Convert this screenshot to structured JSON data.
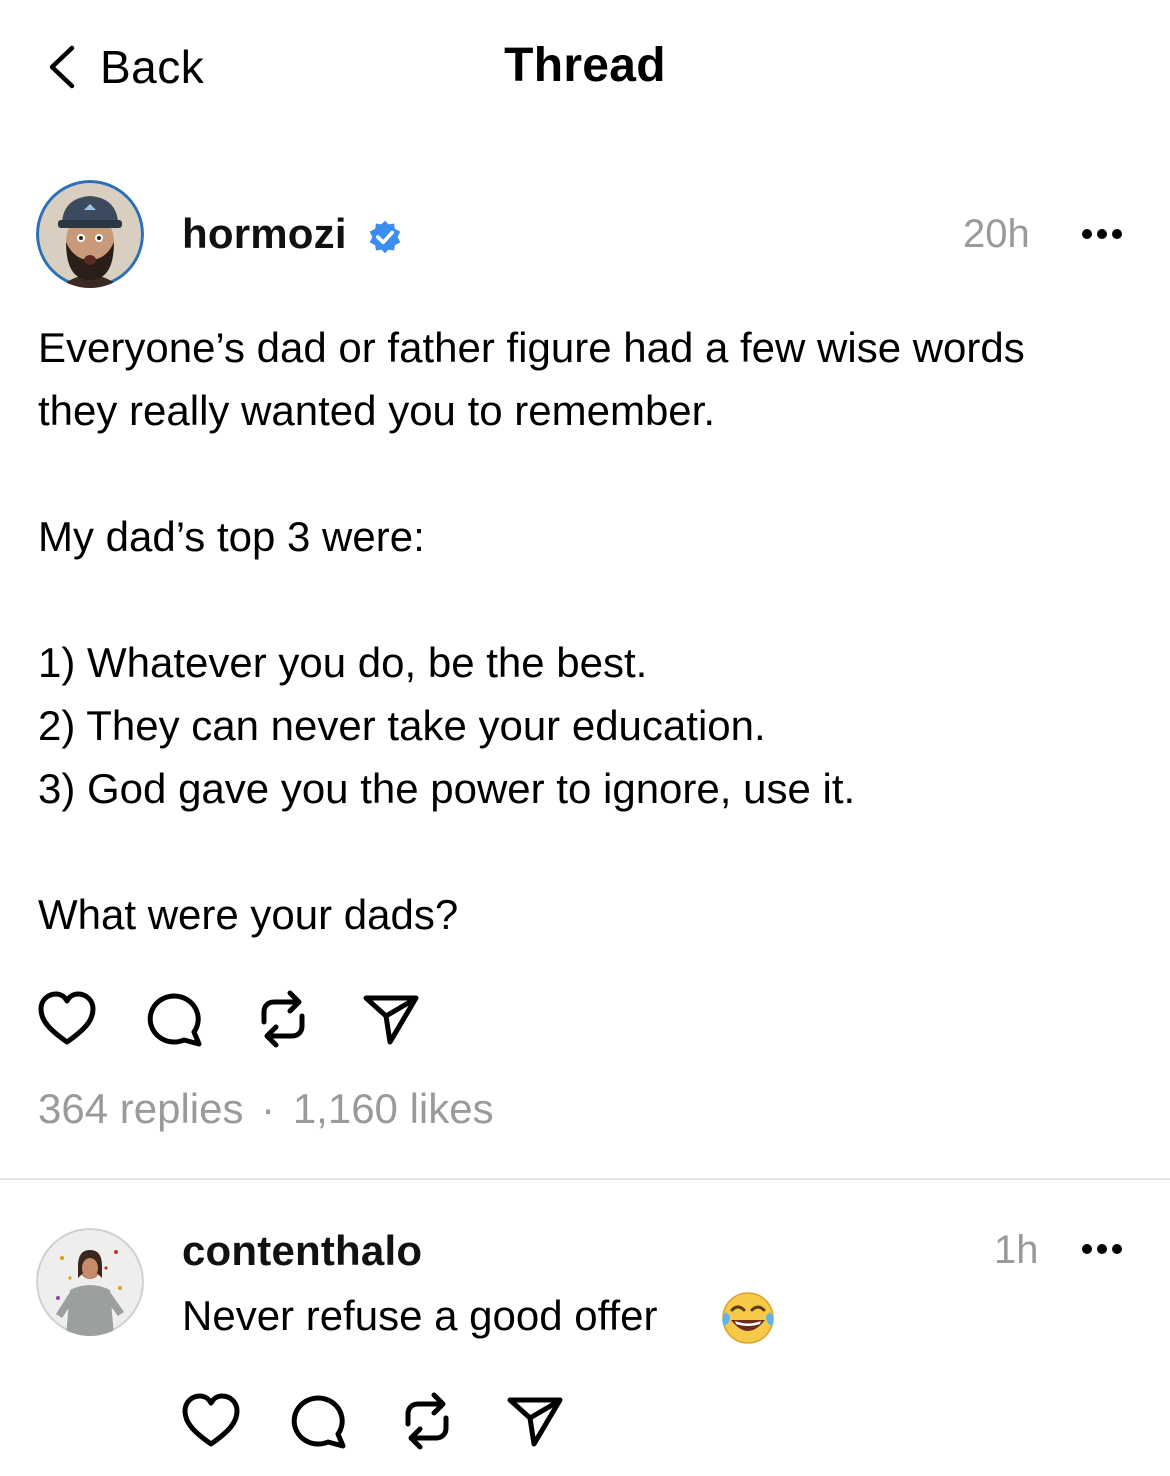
{
  "nav": {
    "back_label": "Back",
    "title": "Thread"
  },
  "post": {
    "username": "hormozi",
    "verified": true,
    "time": "20h",
    "paragraphs": [
      [
        "Everyone’s dad or father figure had a few wise words",
        "they really wanted you to remember."
      ],
      [
        "My dad’s top 3 were:"
      ],
      [
        "1) Whatever you do, be the best.",
        "2) They can never take your education.",
        "3) God gave you the power to ignore, use it."
      ],
      [
        "What were your dads?"
      ]
    ],
    "replies_count": "364 replies",
    "separator": "·",
    "likes_count": "1,160 likes"
  },
  "reply": {
    "username": "contenthalo",
    "time": "1h",
    "text": "Never refuse a good offer",
    "emoji_name": "face-with-tears-of-joy"
  },
  "icons": {
    "back": "chevron-left-icon",
    "verified": "verified-badge-icon",
    "more": "ellipsis-icon",
    "like": "heart-icon",
    "comment": "speech-bubble-icon",
    "repost": "repost-icon",
    "share": "paper-plane-icon"
  },
  "colors": {
    "text": "#000000",
    "secondary_text": "#9a9a9a",
    "verified_blue": "#3b8ef0",
    "divider": "#e3e3e3"
  }
}
